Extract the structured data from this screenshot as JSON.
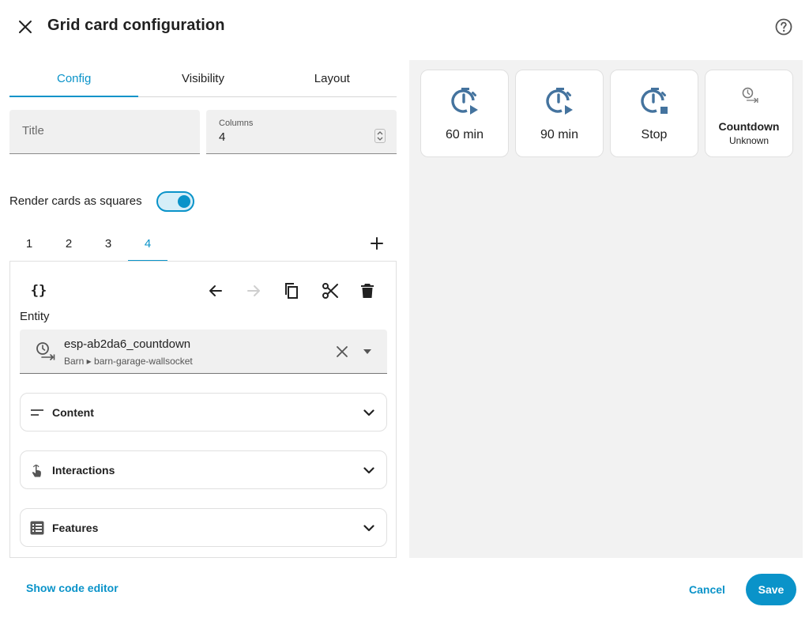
{
  "dialog": {
    "title": "Grid card configuration"
  },
  "icons": {
    "close": "close-icon",
    "help": "help-circle-icon",
    "add": "plus-icon",
    "code": "code-braces-icon",
    "undo": "arrow-left-icon",
    "redo": "arrow-right-icon",
    "copy": "copy-icon",
    "cut": "scissors-icon",
    "delete": "trash-icon",
    "entity": "timer-clock-icon",
    "clear": "close-icon",
    "caret": "caret-down-icon"
  },
  "tabs": [
    {
      "label": "Config",
      "active": true
    },
    {
      "label": "Visibility",
      "active": false
    },
    {
      "label": "Layout",
      "active": false
    }
  ],
  "fields": {
    "title_placeholder": "Title",
    "title_value": "",
    "columns_label": "Columns",
    "columns_value": "4"
  },
  "toggle": {
    "label": "Render cards as squares",
    "on": true
  },
  "card_tabs": [
    "1",
    "2",
    "3",
    "4"
  ],
  "active_card_tab": "4",
  "editor": {
    "code_glyph": "{}",
    "entity_label": "Entity",
    "entity_name": "esp-ab2da6_countdown",
    "entity_context": "Barn ▸ barn-garage-wallsocket",
    "expanders": [
      {
        "label": "Content",
        "icon": "text-short-icon"
      },
      {
        "label": "Interactions",
        "icon": "gesture-tap-icon"
      },
      {
        "label": "Features",
        "icon": "list-box-icon"
      }
    ]
  },
  "preview": {
    "tiles": [
      {
        "label": "60 min",
        "icon": "timer-play-icon"
      },
      {
        "label": "90 min",
        "icon": "timer-play-icon"
      },
      {
        "label": "Stop",
        "icon": "timer-stop-icon"
      }
    ],
    "entity_tile": {
      "name": "Countdown",
      "state": "Unknown",
      "icon": "timer-clock-icon"
    }
  },
  "footer": {
    "code_editor_link": "Show code editor",
    "cancel": "Cancel",
    "save": "Save"
  },
  "colors": {
    "accent": "#0a93c9",
    "icon_blue": "#44739e",
    "preview_bg": "#f2f2f2"
  }
}
